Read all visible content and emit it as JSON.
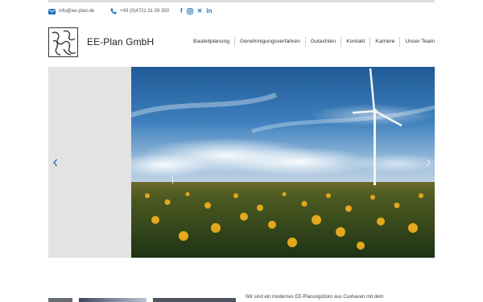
{
  "topbar": {
    "email": "info@ee-plan.de",
    "phone": "+49 (0)4721 31 09 350",
    "social": [
      "facebook-icon",
      "instagram-icon",
      "xing-icon",
      "linkedin-icon"
    ]
  },
  "header": {
    "brand": "EE-Plan GmbH",
    "nav": [
      "Bauleitplanung",
      "Genehmigungsverfahren",
      "Gutachten",
      "Kontakt",
      "Karriere",
      "Unser Team"
    ]
  },
  "intro": {
    "text": "Wir sind ein modernes EE-Planungsbüro aus Cuxhaven mit dem"
  },
  "colors": {
    "accent": "#1e73be",
    "sky_top": "#1f5a96",
    "field": "#2e4a1c"
  }
}
